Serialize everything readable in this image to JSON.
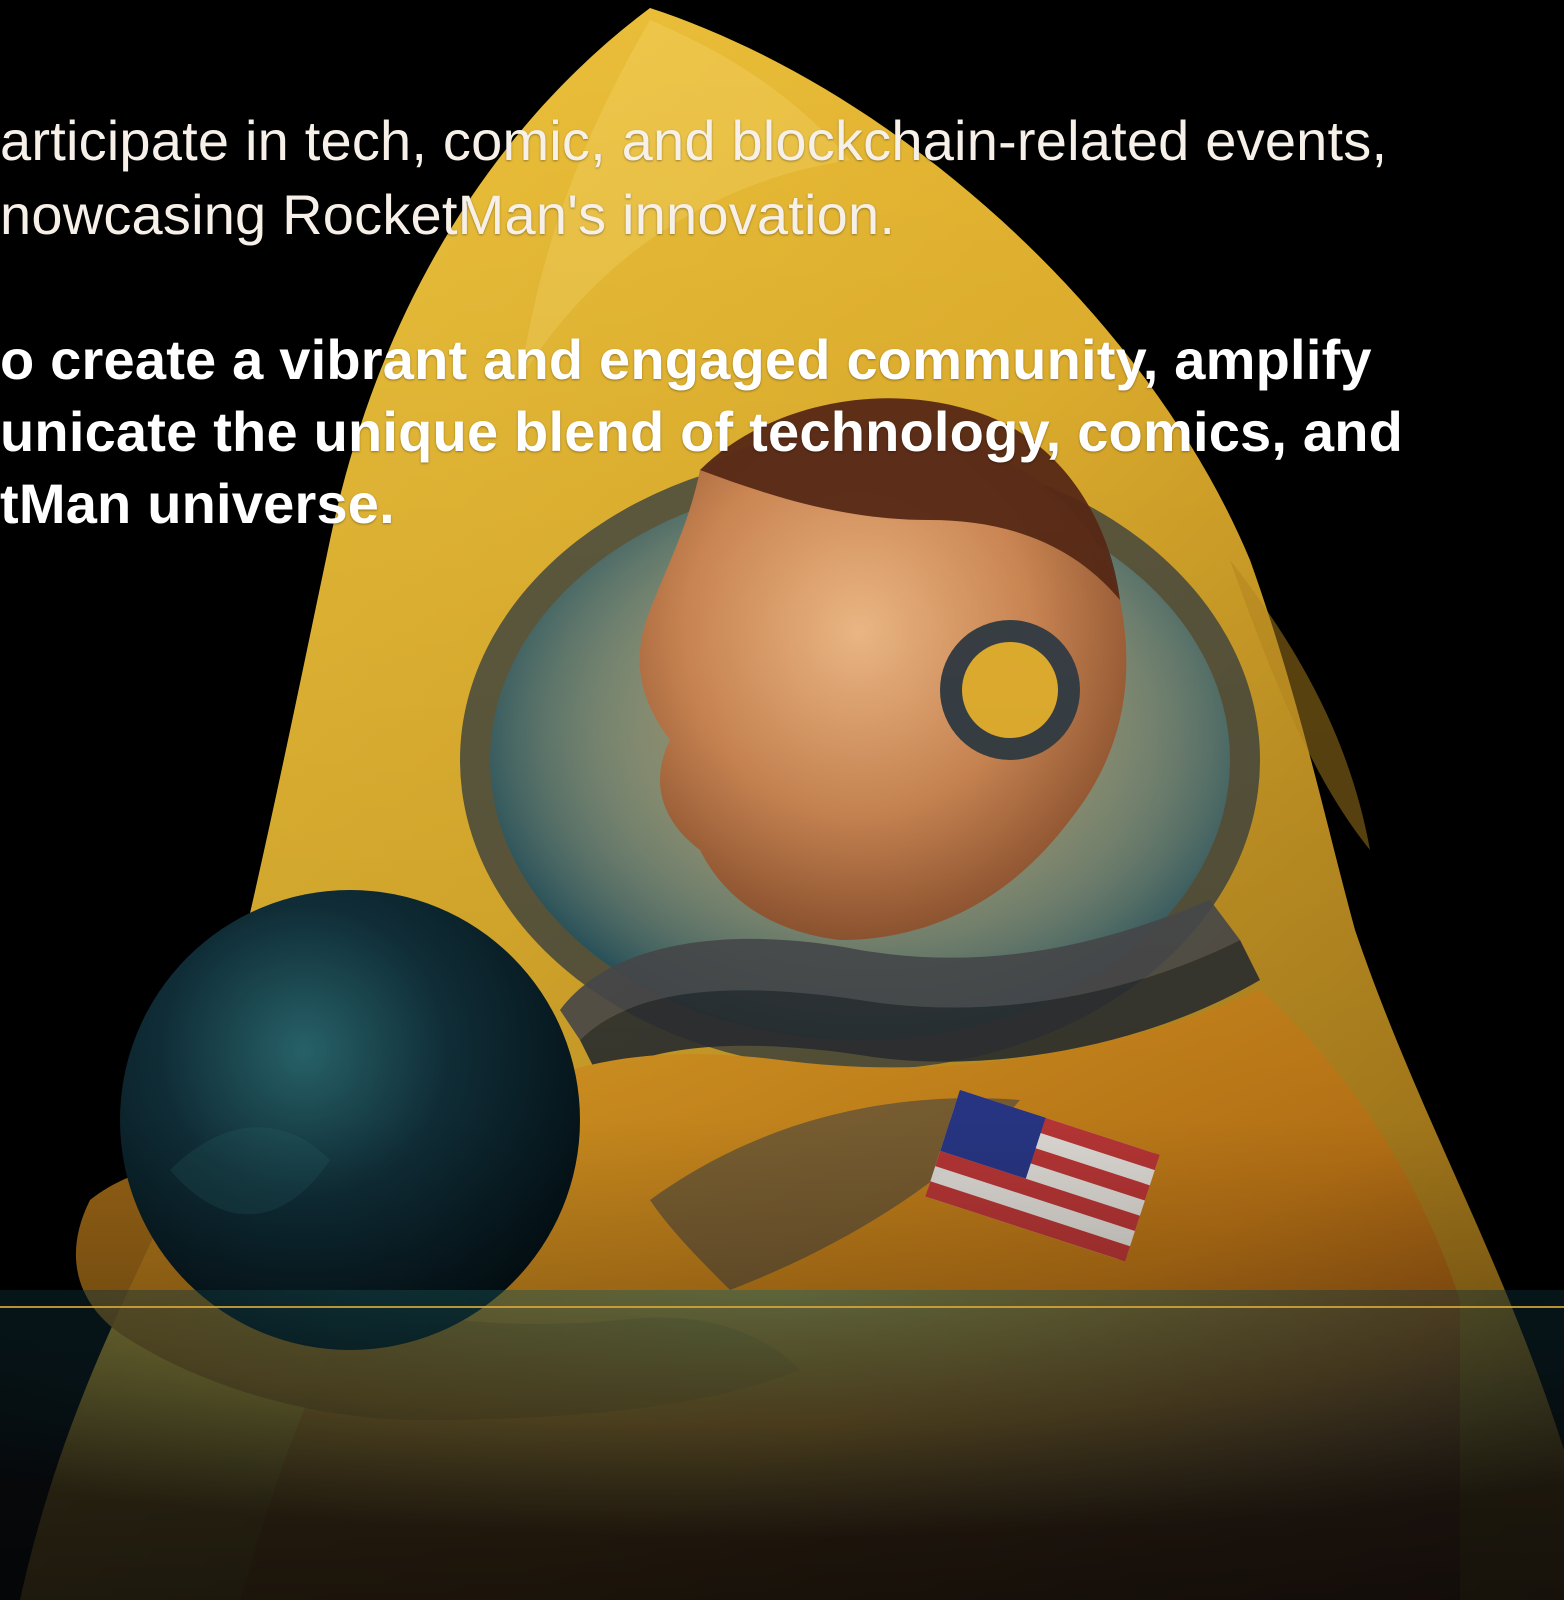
{
  "content": {
    "paragraph_1": {
      "line_1": "articipate in tech, comic, and blockchain-related events,",
      "line_2": "nowcasing RocketMan's innovation."
    },
    "paragraph_2": {
      "line_1": "o create a vibrant and engaged community, amplify",
      "line_2": "unicate the unique blend of technology, comics, and",
      "line_3": "tMan universe."
    }
  },
  "colors": {
    "background": "#000000",
    "rocket_yellow": "#e9b72a",
    "suit_yellow": "#d99a1f",
    "helmet_teal": "#2f6b73",
    "divider_gold": "#d8a73a"
  },
  "icons": {
    "illustration": "astronaut-rocket-illustration"
  }
}
